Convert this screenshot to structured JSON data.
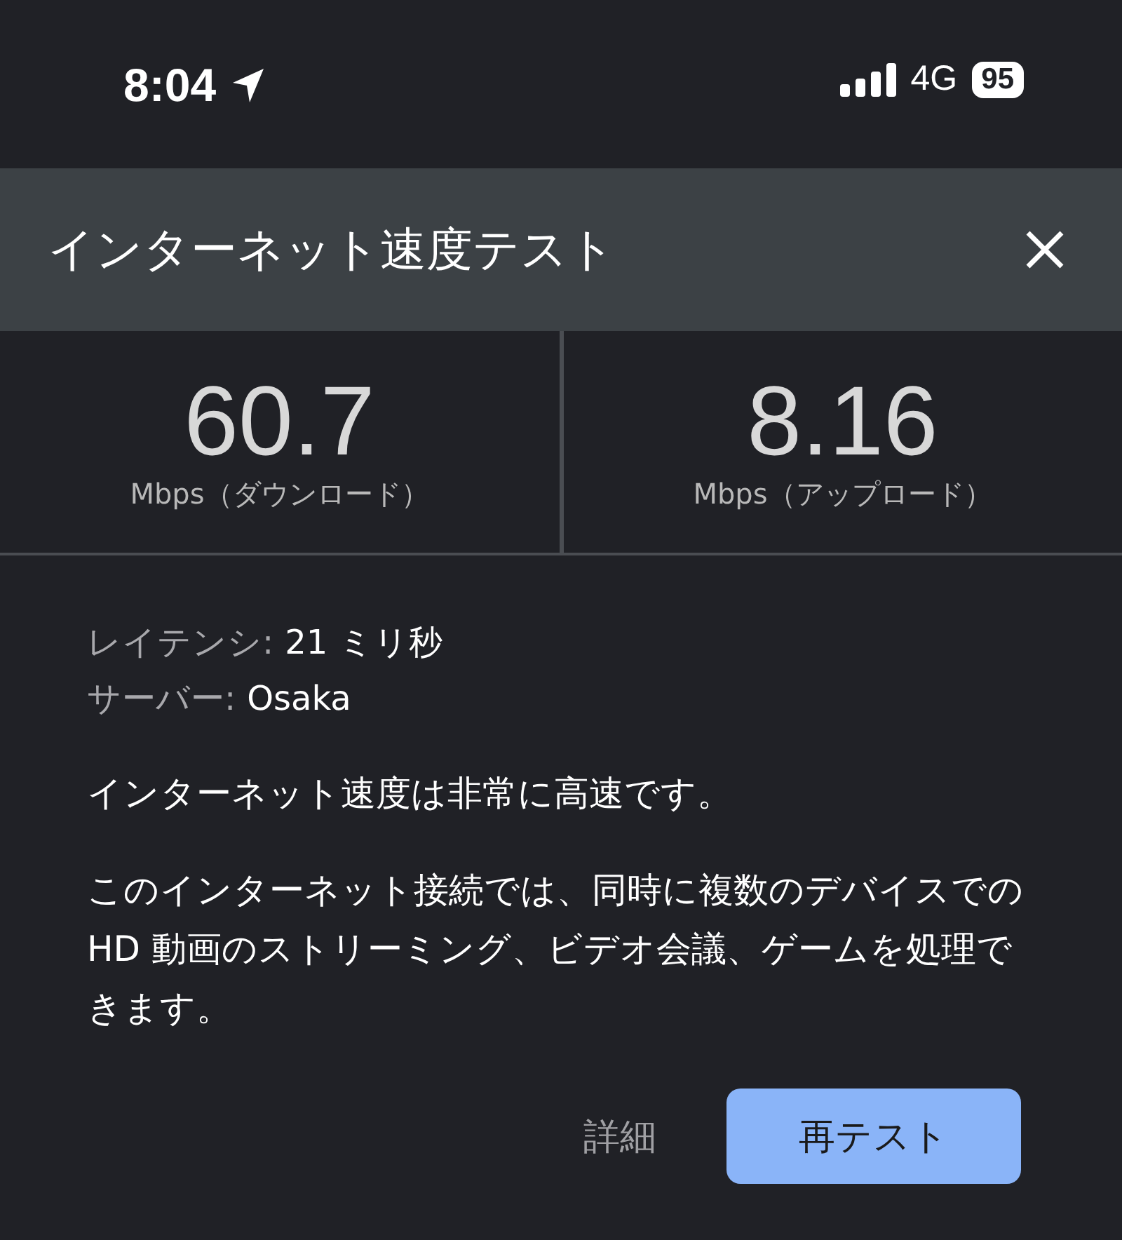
{
  "status_bar": {
    "time": "8:04",
    "network": "4G",
    "battery": "95"
  },
  "header": {
    "title": "インターネット速度テスト"
  },
  "results": [
    {
      "value": "60.7",
      "unit": "Mbps（ダウンロード）"
    },
    {
      "value": "8.16",
      "unit": "Mbps（アップロード）"
    }
  ],
  "details": [
    {
      "label": "レイテンシ:",
      "value": "21 ミリ秒"
    },
    {
      "label": "サーバー:",
      "value": "Osaka"
    }
  ],
  "summary": "インターネット速度は非常に高速です。",
  "description": "このインターネット接続では、同時に複数のデバイスでの HD 動画のストリーミング、ビデオ会議、ゲームを処理できます。",
  "buttons": [
    {
      "label": "詳細",
      "kind": "text"
    },
    {
      "label": "再テスト",
      "kind": "filled"
    }
  ]
}
